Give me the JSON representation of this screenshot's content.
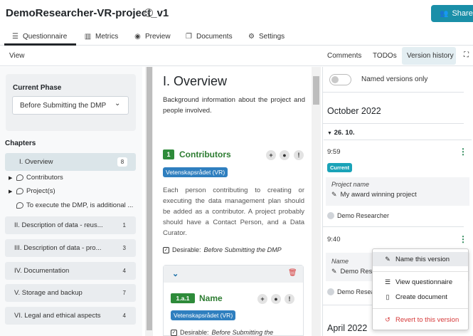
{
  "project": {
    "title": "DemoResearcher-VR-project_v1"
  },
  "share_label": "Share",
  "tabs": [
    {
      "label": "Questionnaire",
      "icon": "list-icon"
    },
    {
      "label": "Metrics",
      "icon": "bar-chart-icon"
    },
    {
      "label": "Preview",
      "icon": "eye-icon"
    },
    {
      "label": "Documents",
      "icon": "copy-icon"
    },
    {
      "label": "Settings",
      "icon": "gears-icon"
    }
  ],
  "toolbar": {
    "view_label": "View",
    "comments_label": "Comments",
    "todos_label": "TODOs",
    "version_history_label": "Version history"
  },
  "phase": {
    "heading": "Current Phase",
    "selected": "Before Submitting the DMP"
  },
  "chapters": {
    "heading": "Chapters",
    "items": [
      {
        "label": "I. Overview",
        "count": "8"
      },
      {
        "label": "II. Description of data - reus...",
        "count": "1"
      },
      {
        "label": "III. Description of data - pro...",
        "count": "3"
      },
      {
        "label": "IV. Documentation",
        "count": "4"
      },
      {
        "label": "V. Storage and backup",
        "count": "7"
      },
      {
        "label": "VI. Legal and ethical aspects",
        "count": "4"
      }
    ],
    "sub_items": [
      {
        "label": "Contributors"
      },
      {
        "label": "Project(s)"
      },
      {
        "label": "To execute the DMP, is additional ..."
      }
    ]
  },
  "content": {
    "title": "I. Overview",
    "description": "Background information about the project and people involved.",
    "question": {
      "number": "1",
      "title": "Contributors",
      "tag": "Vetenskapsrådet (VR)",
      "text": "Each person contributing to creating or executing the data management plan should be added as a contributor. A project probably should have a Contact Person, and a Data Curator.",
      "desirable_prefix": "Desirable:",
      "desirable_phase": "Before Submitting the DMP"
    },
    "sub_question": {
      "number": "1.a.1",
      "title": "Name",
      "tag": "Vetenskapsrådet (VR)",
      "desirable_prefix": "Desirable:",
      "desirable_phase": "Before Submitting the"
    }
  },
  "versions": {
    "named_only_label": "Named versions only",
    "months": [
      "October 2022",
      "April 2022"
    ],
    "day": "26. 10.",
    "entries": [
      {
        "time": "9:59",
        "badge": "Current",
        "name_label": "Project name",
        "name_value": "My award winning project",
        "author": "Demo Researcher"
      },
      {
        "time": "9:40",
        "name_label": "Name",
        "name_value": "Demo Res",
        "author": "Demo Researc"
      }
    ]
  },
  "dropdown": {
    "items": [
      {
        "label": "Name this version",
        "icon": "edit-icon"
      },
      {
        "label": "View questionnaire",
        "icon": "list-icon"
      },
      {
        "label": "Create document",
        "icon": "file-icon"
      },
      {
        "label": "Revert to this version",
        "icon": "history-icon"
      }
    ]
  },
  "colors": {
    "accent": "#1a8fa8",
    "question_green": "#2e7d32",
    "tag_blue": "#2f7fbf",
    "danger": "#d63939"
  }
}
